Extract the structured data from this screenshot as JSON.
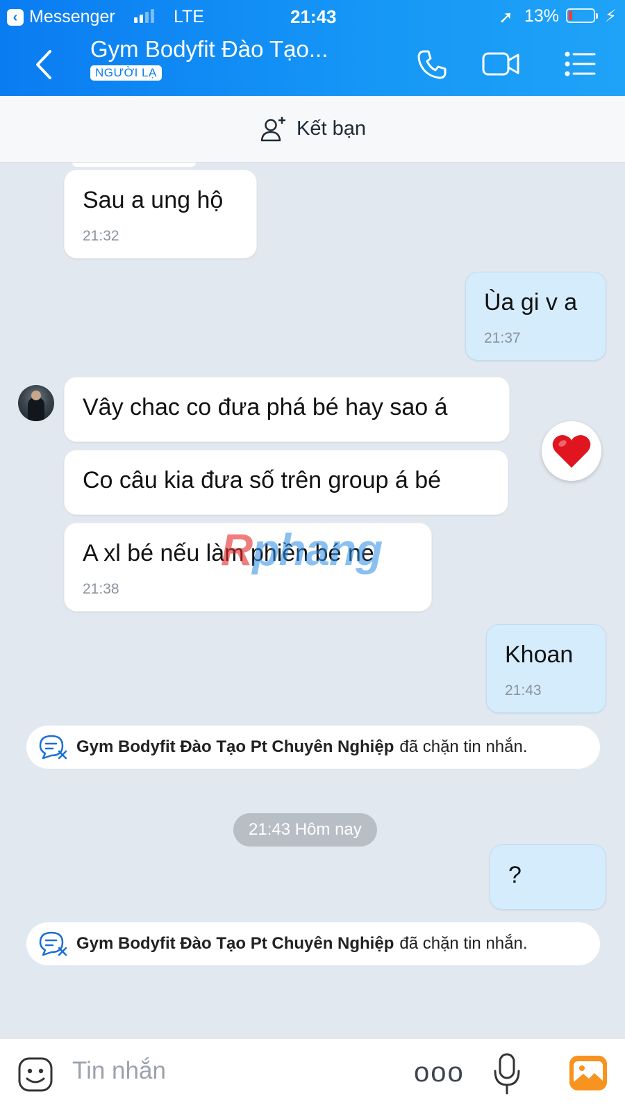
{
  "status_bar": {
    "back_app": "Messenger",
    "carrier": "LTE",
    "time": "21:43",
    "battery": "13%"
  },
  "header": {
    "title": "Gym Bodyfit Đào Tạo...",
    "badge": "NGƯỜI LẠ"
  },
  "friend_bar": {
    "label": "Kết bạn"
  },
  "messages": [
    {
      "text": "Sau a ung hộ",
      "time": "21:32"
    },
    {
      "text": "Ùa gi v a",
      "time": "21:37"
    },
    {
      "text": "Vây chac co đưa phá bé hay sao á"
    },
    {
      "text": "Co câu kia đưa số trên group á bé"
    },
    {
      "text": "A xl bé nếu làm phiền bé ne",
      "time": "21:38"
    },
    {
      "text": "Khoan",
      "time": "21:43"
    },
    {
      "text": "?"
    }
  ],
  "reaction": {
    "icon": "heart-icon",
    "color": "#e0151f"
  },
  "watermark": {
    "first": "R",
    "rest": "phang"
  },
  "system_notices": [
    {
      "name": "Gym Bodyfit Đào Tạo Pt Chuyên Nghiệp",
      "text": "đã chặn tin nhắn."
    },
    {
      "name": "Gym Bodyfit Đào Tạo Pt Chuyên Nghiệp",
      "text": "đã chặn tin nhắn."
    }
  ],
  "time_divider": "21:43 Hôm nay",
  "input": {
    "placeholder": "Tin nhắn",
    "more": "ooo"
  },
  "colors": {
    "accent": "#0a7cf2",
    "outgoing_bubble": "#d5ecfc",
    "background": "#e2e8ef"
  }
}
